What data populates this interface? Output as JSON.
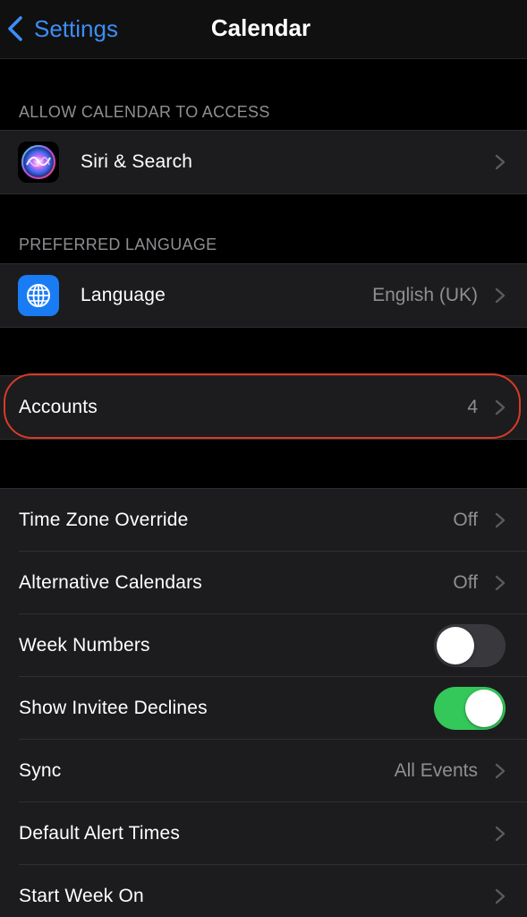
{
  "nav": {
    "back_label": "Settings",
    "title": "Calendar"
  },
  "sections": {
    "access_header": "ALLOW CALENDAR TO ACCESS",
    "language_header": "PREFERRED LANGUAGE"
  },
  "rows": {
    "siri": {
      "label": "Siri & Search",
      "icon": "siri-icon"
    },
    "language": {
      "label": "Language",
      "value": "English (UK)",
      "icon": "globe-icon"
    },
    "accounts": {
      "label": "Accounts",
      "value": "4"
    },
    "time_zone": {
      "label": "Time Zone Override",
      "value": "Off"
    },
    "alt_calendars": {
      "label": "Alternative Calendars",
      "value": "Off"
    },
    "week_numbers": {
      "label": "Week Numbers",
      "toggle": false
    },
    "invitee_declines": {
      "label": "Show Invitee Declines",
      "toggle": true
    },
    "sync": {
      "label": "Sync",
      "value": "All Events"
    },
    "alert_times": {
      "label": "Default Alert Times"
    },
    "start_week": {
      "label": "Start Week On"
    }
  },
  "colors": {
    "accent": "#3c8ef7",
    "toggle_on": "#34c759",
    "toggle_off": "#39393d",
    "highlight": "#d93a27",
    "cell_bg": "#1c1c1e",
    "secondary_text": "#8e8e93"
  }
}
